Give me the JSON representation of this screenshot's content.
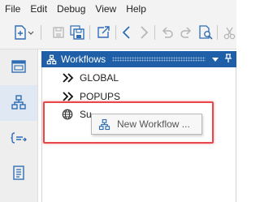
{
  "menu": {
    "items": [
      "File",
      "Edit",
      "Debug",
      "View",
      "Help"
    ]
  },
  "toolbar": {
    "buttons": [
      {
        "name": "new-dropdown",
        "icon": "new-document-icon"
      },
      {
        "name": "save",
        "icon": "save-icon",
        "enabled": false
      },
      {
        "name": "save-all",
        "icon": "save-all-icon"
      },
      {
        "name": "export",
        "icon": "export-icon"
      },
      {
        "name": "back",
        "icon": "chevron-left-icon"
      },
      {
        "name": "forward",
        "icon": "chevron-right-icon",
        "enabled": false
      },
      {
        "name": "undo",
        "icon": "undo-icon",
        "enabled": false
      },
      {
        "name": "redo",
        "icon": "redo-icon",
        "enabled": false
      },
      {
        "name": "find",
        "icon": "find-icon"
      },
      {
        "name": "cut",
        "icon": "scissors-icon",
        "enabled": false
      }
    ]
  },
  "activity_bar": {
    "items": [
      {
        "name": "window",
        "icon": "window-icon",
        "active": false
      },
      {
        "name": "workflows",
        "icon": "workflow-icon",
        "active": true
      },
      {
        "name": "variables",
        "icon": "variables-icon",
        "active": false
      },
      {
        "name": "document",
        "icon": "document-list-icon",
        "active": false
      }
    ]
  },
  "panel": {
    "title": "Workflows",
    "title_icon": "workflow-icon",
    "tree": [
      {
        "label": "GLOBAL",
        "icon": "double-chevron-icon"
      },
      {
        "label": "POPUPS",
        "icon": "double-chevron-icon"
      },
      {
        "label": "Su",
        "icon": "globe-icon"
      }
    ]
  },
  "context_popup": {
    "item_label": "New Workflow ...",
    "item_icon": "workflow-icon"
  },
  "colors": {
    "accent": "#1f5fa8",
    "highlight": "#e8474a",
    "icon_blue": "#2f6db5"
  }
}
